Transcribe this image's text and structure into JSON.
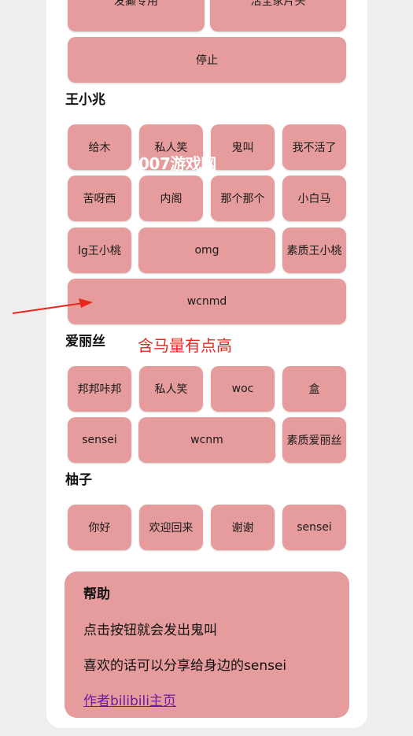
{
  "top_buttons": [
    "发癫专用",
    "活全家片头",
    "停止"
  ],
  "sections": [
    {
      "title": "王小兆",
      "buttons": [
        "给木",
        "私人笑",
        "鬼叫",
        "我不活了",
        "苦呀西",
        "内阁",
        "那个那个",
        "小白马",
        "lg王小桃",
        "omg",
        "素质王小桃",
        "wcnmd"
      ]
    },
    {
      "title": "爱丽丝",
      "buttons": [
        "邦邦咔邦",
        "私人笑",
        "woc",
        "盒",
        "sensei",
        "wcnm",
        "素质爱丽丝"
      ]
    },
    {
      "title": "柚子",
      "buttons": [
        "你好",
        "欢迎回来",
        "谢谢",
        "sensei"
      ]
    }
  ],
  "help": {
    "title": "帮助",
    "line1": "点击按钮就会发出鬼叫",
    "line2": "喜欢的话可以分享给身边的sensei",
    "link": "作者bilibili主页"
  },
  "overlay": {
    "watermark": "007游戏网",
    "annotation": "含马量有点高"
  },
  "colors": {
    "button_bg": "#e69c9c",
    "annotation": "#e8261e",
    "link": "#6a1aa6"
  }
}
